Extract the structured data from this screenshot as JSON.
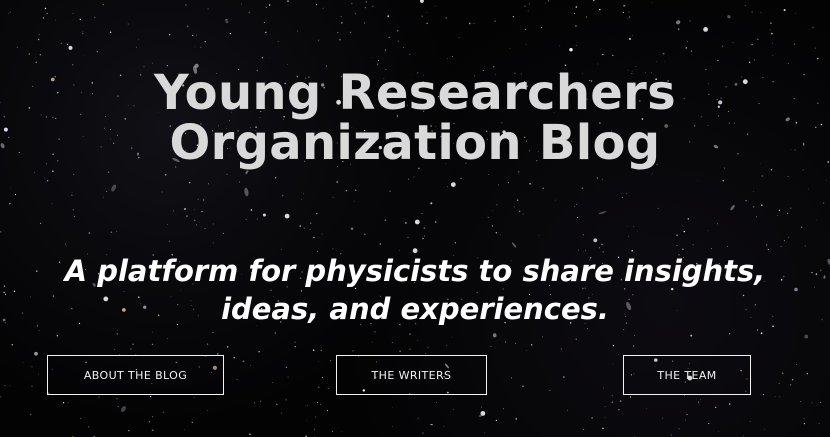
{
  "hero": {
    "title_line1": "Young Researchers",
    "title_line2": "Organization Blog",
    "subtitle_line1": "A platform for physicists to share insights,",
    "subtitle_line2": "ideas, and experiences.",
    "background": "starfield"
  },
  "nav": {
    "about_label": "ABOUT THE BLOG",
    "writers_label": "THE WRITERS",
    "team_label": "THE TEAM"
  },
  "colors": {
    "background": "#030304",
    "title": "#d9d9d9",
    "subtitle": "#ffffff",
    "button_border": "#f2f2f2"
  }
}
